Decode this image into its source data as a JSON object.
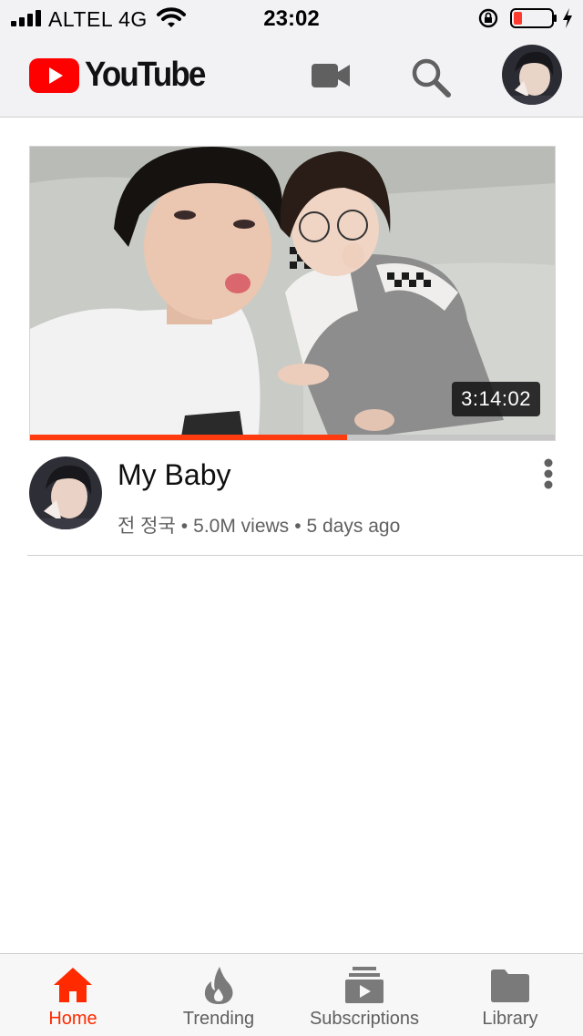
{
  "status_bar": {
    "carrier": "ALTEL 4G",
    "time": "23:02",
    "battery_color": "#ff3b30"
  },
  "header": {
    "logo_text": "YouTube",
    "brand_color": "#ff0000",
    "icons": [
      "video-camera-icon",
      "search-icon",
      "account-avatar"
    ]
  },
  "video": {
    "title": "My Baby",
    "duration": "3:14:02",
    "channel": "전 정국",
    "views": "5.0M views",
    "age": "5 days ago",
    "watched_fraction": 0.605
  },
  "nav": {
    "items": [
      {
        "label": "Home",
        "icon": "home-icon",
        "active": true
      },
      {
        "label": "Trending",
        "icon": "flame-icon",
        "active": false
      },
      {
        "label": "Subscriptions",
        "icon": "subscriptions-icon",
        "active": false
      },
      {
        "label": "Library",
        "icon": "folder-icon",
        "active": false
      }
    ],
    "active_color": "#ff2a00"
  }
}
